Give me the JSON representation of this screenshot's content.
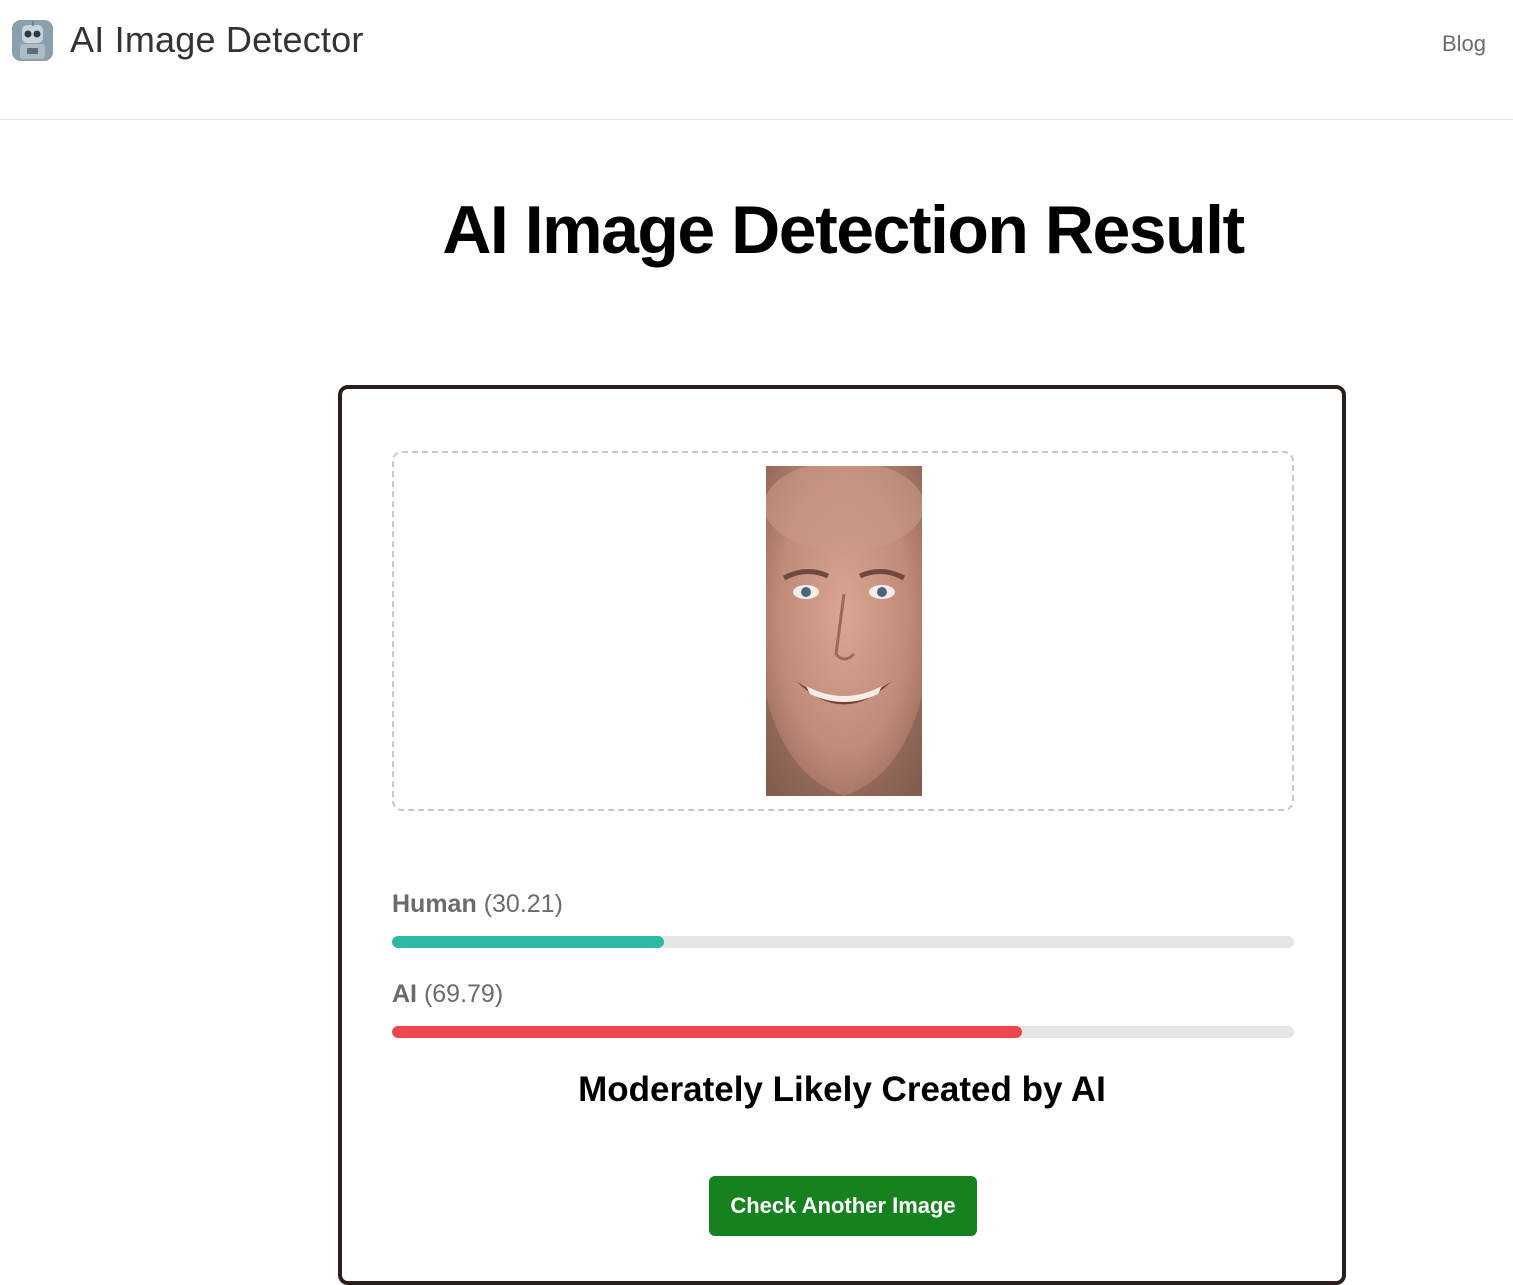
{
  "header": {
    "logo_icon": "robot-icon",
    "app_title": "AI Image Detector",
    "blog_link": "Blog"
  },
  "main": {
    "page_title": "AI Image Detection Result"
  },
  "result": {
    "image_alt": "uploaded-face-photo",
    "human": {
      "label": "Human",
      "value_text": "(30.21)",
      "percent": 30.21,
      "color": "#2bb9a5"
    },
    "ai": {
      "label": "AI",
      "value_text": "(69.79)",
      "percent": 69.79,
      "color": "#e8474b"
    },
    "verdict": "Moderately Likely Created by AI",
    "check_another_label": "Check Another Image",
    "accent_color": "#15821f"
  }
}
